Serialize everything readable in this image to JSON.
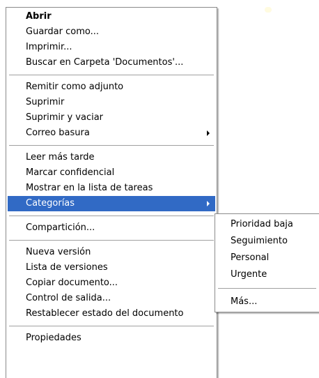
{
  "colors": {
    "highlight": "#316ac5",
    "highlight_text": "#ffffff",
    "separator": "#a0a0a0",
    "border": "#8a8a8a"
  },
  "main_menu": {
    "items": [
      {
        "label": "Abrir"
      },
      {
        "label": "Guardar como..."
      },
      {
        "label": "Imprimir..."
      },
      {
        "label": "Buscar en Carpeta 'Documentos'..."
      },
      {
        "label": "Remitir como adjunto"
      },
      {
        "label": "Suprimir"
      },
      {
        "label": "Suprimir y vaciar"
      },
      {
        "label": "Correo basura",
        "submenu_icon": "chevron-right-icon"
      },
      {
        "label": "Leer más tarde"
      },
      {
        "label": "Marcar confidencial"
      },
      {
        "label": "Mostrar en la lista de tareas"
      },
      {
        "label": "Categorías",
        "submenu_icon": "chevron-right-icon",
        "state": "highlighted"
      },
      {
        "label": "Compartición..."
      },
      {
        "label": "Nueva versión"
      },
      {
        "label": "Lista de versiones"
      },
      {
        "label": "Copiar documento..."
      },
      {
        "label": "Control de salida..."
      },
      {
        "label": "Restablecer estado del documento"
      },
      {
        "label": "Propiedades"
      }
    ]
  },
  "sub_menu": {
    "items": [
      {
        "label": "Prioridad baja"
      },
      {
        "label": "Seguimiento"
      },
      {
        "label": "Personal"
      },
      {
        "label": "Urgente"
      },
      {
        "label": "Más..."
      }
    ]
  }
}
